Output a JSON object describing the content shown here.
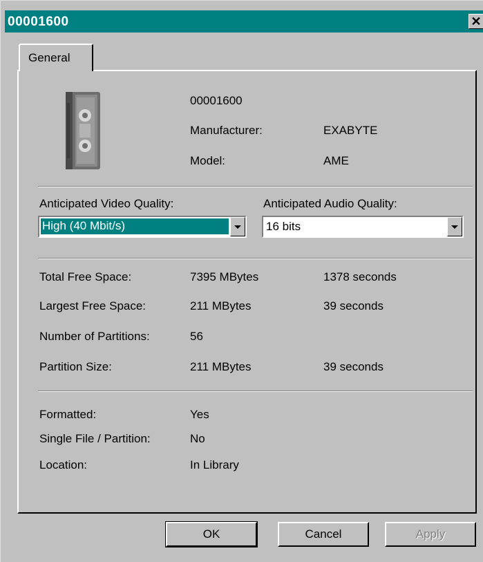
{
  "window": {
    "title": "00001600",
    "close_glyph": "✕"
  },
  "tabs": [
    {
      "label": "General"
    }
  ],
  "media": {
    "icon": "tape-cartridge-icon",
    "name": "00001600",
    "manufacturer_label": "Manufacturer:",
    "manufacturer": "EXABYTE",
    "model_label": "Model:",
    "model": "AME"
  },
  "quality": {
    "video_label": "Anticipated Video Quality:",
    "video_value": "High (40 Mbit/s)",
    "audio_label": "Anticipated Audio Quality:",
    "audio_value": "16 bits"
  },
  "space": {
    "total_label": "Total Free Space:",
    "total_size": "7395 MBytes",
    "total_time": "1378 seconds",
    "largest_label": "Largest Free Space:",
    "largest_size": "211 MBytes",
    "largest_time": "39 seconds",
    "partitions_label": "Number of Partitions:",
    "partitions": "56",
    "partition_size_label": "Partition Size:",
    "partition_size": "211 MBytes",
    "partition_time": "39 seconds"
  },
  "status": {
    "formatted_label": "Formatted:",
    "formatted": "Yes",
    "single_label": "Single File / Partition:",
    "single": "No",
    "location_label": "Location:",
    "location": "In Library"
  },
  "buttons": {
    "ok": "OK",
    "cancel": "Cancel",
    "apply": "Apply"
  },
  "colors": {
    "titlebar": "#008080",
    "selection": "#008080",
    "face": "#c0c0c0"
  }
}
